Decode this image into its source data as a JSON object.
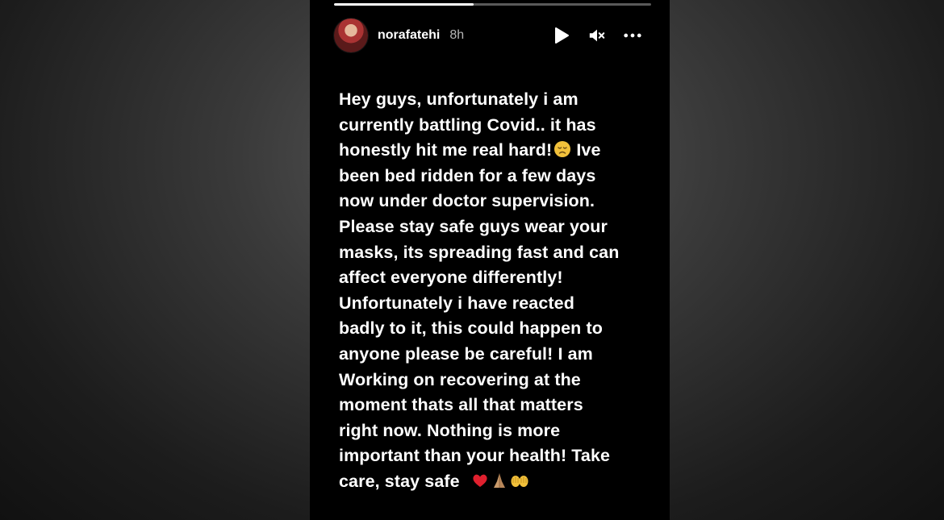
{
  "story": {
    "progress_fraction": 0.44,
    "username": "norafatehi",
    "time_ago": "8h",
    "icons": {
      "avatar": "profile-avatar",
      "play": "play-icon",
      "mute": "speaker-muted-icon",
      "more": "more-options-icon"
    },
    "text_lines": [
      "Hey guys, unfortunately i am",
      "currently battling Covid.. it has",
      "honestly hit me real hard!",
      "been bed ridden for a few days",
      "now under doctor supervision.",
      "Please stay safe guys wear your",
      "masks, its spreading fast and can",
      "affect everyone differently!",
      "Unfortunately i have reacted",
      "badly to it, this could happen to",
      "anyone please be careful! I am",
      "Working on recovering at the",
      "moment thats all that matters",
      "right now. Nothing is more",
      "important than your health! Take",
      "care, stay safe"
    ],
    "line3_tail": "Ive",
    "emojis": {
      "disappointed": "disappointed-face-emoji",
      "heart": "red-heart-emoji",
      "pray": "folded-hands-emoji",
      "hands": "open-hands-emoji"
    }
  }
}
